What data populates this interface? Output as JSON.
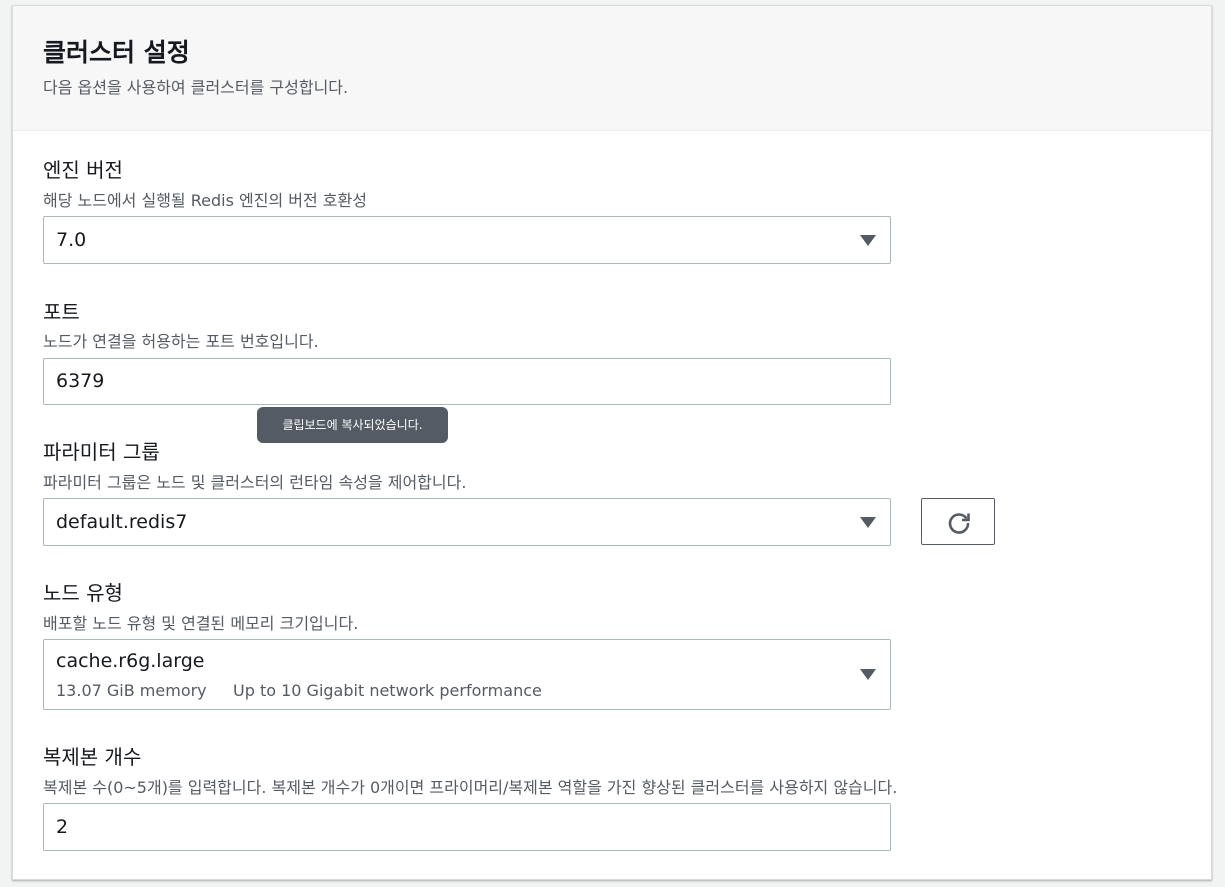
{
  "header": {
    "title": "클러스터 설정",
    "description": "다음 옵션을 사용하여 클러스터를 구성합니다."
  },
  "engine_version": {
    "label": "엔진 버전",
    "description": "해당 노드에서 실행될 Redis 엔진의 버전 호환성",
    "value": "7.0"
  },
  "port": {
    "label": "포트",
    "description": "노드가 연결을 허용하는 포트 번호입니다.",
    "value": "6379"
  },
  "tooltip": {
    "text": "클립보드에 복사되었습니다."
  },
  "parameter_group": {
    "label": "파라미터 그룹",
    "description": "파라미터 그룹은 노드 및 클러스터의 런타임 속성을 제어합니다.",
    "value": "default.redis7",
    "refresh_icon": "refresh-icon"
  },
  "node_type": {
    "label": "노드 유형",
    "description": "배포할 노드 유형 및 연결된 메모리 크기입니다.",
    "value": "cache.r6g.large",
    "memory": "13.07 GiB memory",
    "network": "Up to 10 Gigabit network performance"
  },
  "replicas": {
    "label": "복제본 개수",
    "description": "복제본 수(0~5개)를 입력합니다. 복제본 개수가 0개이면 프라이머리/복제본 역할을 가진 향상된 클러스터를 사용하지 않습니다.",
    "value": "2"
  },
  "colors": {
    "text_primary": "#16191f",
    "text_secondary": "#545b64",
    "border": "#aab7b8",
    "tooltip_bg": "#545b64"
  }
}
